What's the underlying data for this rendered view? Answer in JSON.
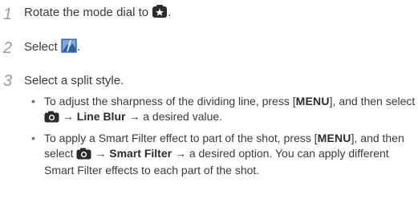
{
  "steps": [
    {
      "number": "1",
      "text": "Rotate the mode dial to",
      "icon": "scene-star-icon",
      "end": "."
    },
    {
      "number": "2",
      "text": "Select",
      "icon": "split-shot-icon",
      "end": "."
    },
    {
      "number": "3",
      "text": "Select a split style."
    }
  ],
  "bullets": [
    {
      "part1": "To adjust the sharpness of the dividing line, press [",
      "menu": "MENU",
      "part2": "], and then select",
      "icon": "camera-icon",
      "arrow1": " → ",
      "option": "Line Blur",
      "arrow2": " → ",
      "end": "a desired value."
    },
    {
      "part1": "To apply a Smart Filter effect to part of the shot, press [",
      "menu": "MENU",
      "part2": "], and then select",
      "icon": "camera-icon",
      "arrow1": " → ",
      "option": "Smart Filter",
      "arrow2": " → ",
      "end": "a desired option. You can apply different Smart Filter effects to each part of the shot."
    }
  ],
  "colors": {
    "step_number": "#9b9b9b",
    "text": "#3a3a3a",
    "icon_dark": "#2b2b2b",
    "icon_blue": "#3d6fb6"
  }
}
